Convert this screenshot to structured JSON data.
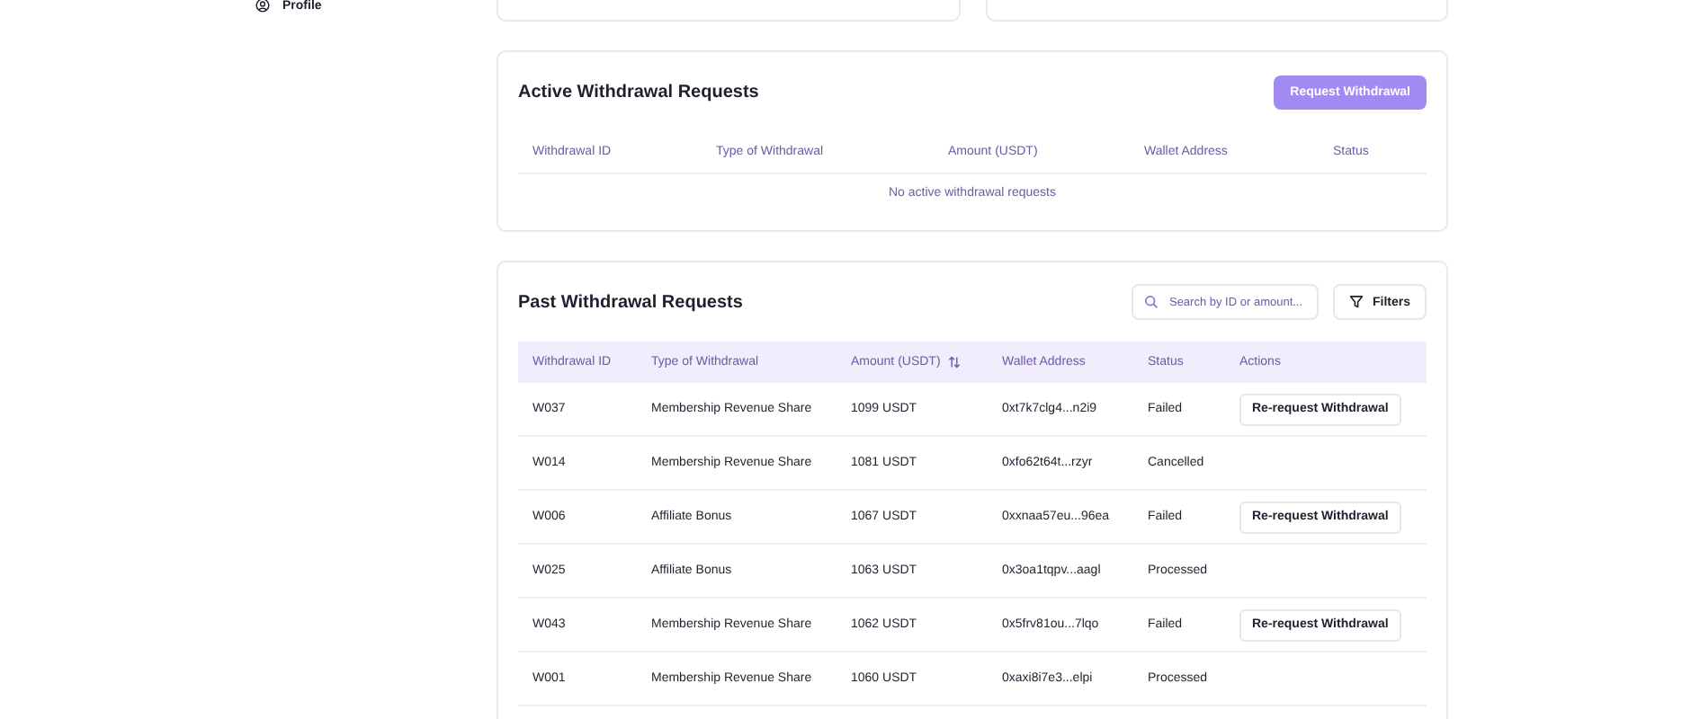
{
  "sidebar": {
    "items": [
      {
        "label": "Profile",
        "selected": false
      }
    ]
  },
  "active_requests": {
    "title": "Active Withdrawal Requests",
    "button": "Request Withdrawal",
    "columns": [
      "Withdrawal ID",
      "Type of Withdrawal",
      "Amount (USDT)",
      "Wallet Address",
      "Status"
    ],
    "empty_message": "No active withdrawal requests"
  },
  "past_requests": {
    "title": "Past Withdrawal Requests",
    "search": {
      "placeholder": "Search by ID or amount..."
    },
    "filters_button": "Filters",
    "columns": [
      {
        "label": "Withdrawal ID",
        "sortable": false
      },
      {
        "label": "Type of Withdrawal",
        "sortable": false
      },
      {
        "label": "Amount (USDT)",
        "sortable": true
      },
      {
        "label": "Wallet Address",
        "sortable": false
      },
      {
        "label": "Status",
        "sortable": false
      },
      {
        "label": "Actions",
        "sortable": false
      }
    ],
    "rows": [
      {
        "id": "W037",
        "type": "Membership Revenue Share",
        "amount": "1099 USDT",
        "wallet": "0xt7k7clg4...n2i9",
        "status": "Failed",
        "action": "Re-request Withdrawal"
      },
      {
        "id": "W014",
        "type": "Membership Revenue Share",
        "amount": "1081 USDT",
        "wallet": "0xfo62t64t...rzyr",
        "status": "Cancelled"
      },
      {
        "id": "W006",
        "type": "Affiliate Bonus",
        "amount": "1067 USDT",
        "wallet": "0xxnaa57eu...96ea",
        "status": "Failed",
        "action": "Re-request Withdrawal"
      },
      {
        "id": "W025",
        "type": "Affiliate Bonus",
        "amount": "1063 USDT",
        "wallet": "0x3oa1tqpv...aagl",
        "status": "Processed"
      },
      {
        "id": "W043",
        "type": "Membership Revenue Share",
        "amount": "1062 USDT",
        "wallet": "0x5frv81ou...7lqo",
        "status": "Failed",
        "action": "Re-request Withdrawal"
      },
      {
        "id": "W001",
        "type": "Membership Revenue Share",
        "amount": "1060 USDT",
        "wallet": "0xaxi8i7e3...elpi",
        "status": "Processed"
      }
    ]
  }
}
